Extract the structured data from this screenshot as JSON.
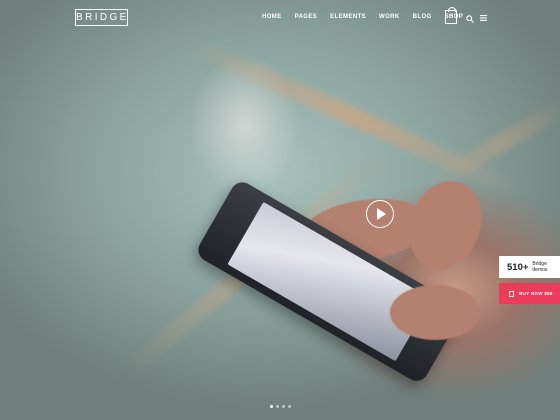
{
  "brand": {
    "logo": "BRIDGE"
  },
  "nav": {
    "items": [
      "HOME",
      "PAGES",
      "ELEMENTS",
      "WORK",
      "BLOG",
      "SHOP"
    ],
    "cart_count": "0",
    "icons": [
      "search-icon",
      "menu-icon"
    ]
  },
  "hero": {
    "play_icon": "play-icon",
    "slides": 4,
    "active_slide": 1
  },
  "demos_badge": {
    "count": "510+",
    "label_line1": "Bridge",
    "label_line2": "demos"
  },
  "buy_button": {
    "label": "BUY NOW $59",
    "icon": "shopping-bag-icon"
  },
  "colors": {
    "accent": "#ec3c5b",
    "text_light": "#ffffff"
  }
}
